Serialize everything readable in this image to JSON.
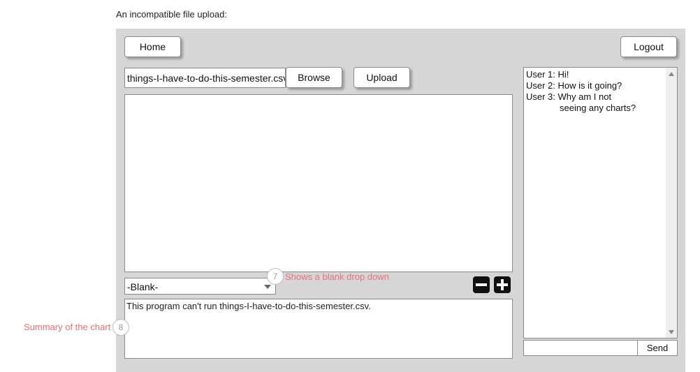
{
  "caption": "An incompatible file upload:",
  "toolbar": {
    "home_label": "Home",
    "logout_label": "Logout"
  },
  "file_upload": {
    "file_name": "things-I-have-to-do-this-semester.csv",
    "browse_label": "Browse",
    "upload_label": "Upload"
  },
  "chart_type_select": {
    "selected": "-Blank-"
  },
  "zoom": {
    "minus_icon": "minus-icon",
    "plus_icon": "plus-icon"
  },
  "summary_text": "This program can't run things-I-have-to-do-this-semester.csv.",
  "chat": {
    "messages": [
      {
        "line": "User 1: Hi!"
      },
      {
        "line": "User 2: How is it going?"
      },
      {
        "line": "User 3: Why am I not"
      },
      {
        "line": "seeing any charts?"
      }
    ],
    "input_value": "",
    "send_label": "Send"
  },
  "annotations": [
    {
      "number": "7",
      "text": "Shows a blank drop down"
    },
    {
      "number": "8",
      "text": "Summary of the chart"
    }
  ],
  "colors": {
    "panel_bg": "#d6d6d6",
    "annotation_text": "#e8707a"
  }
}
